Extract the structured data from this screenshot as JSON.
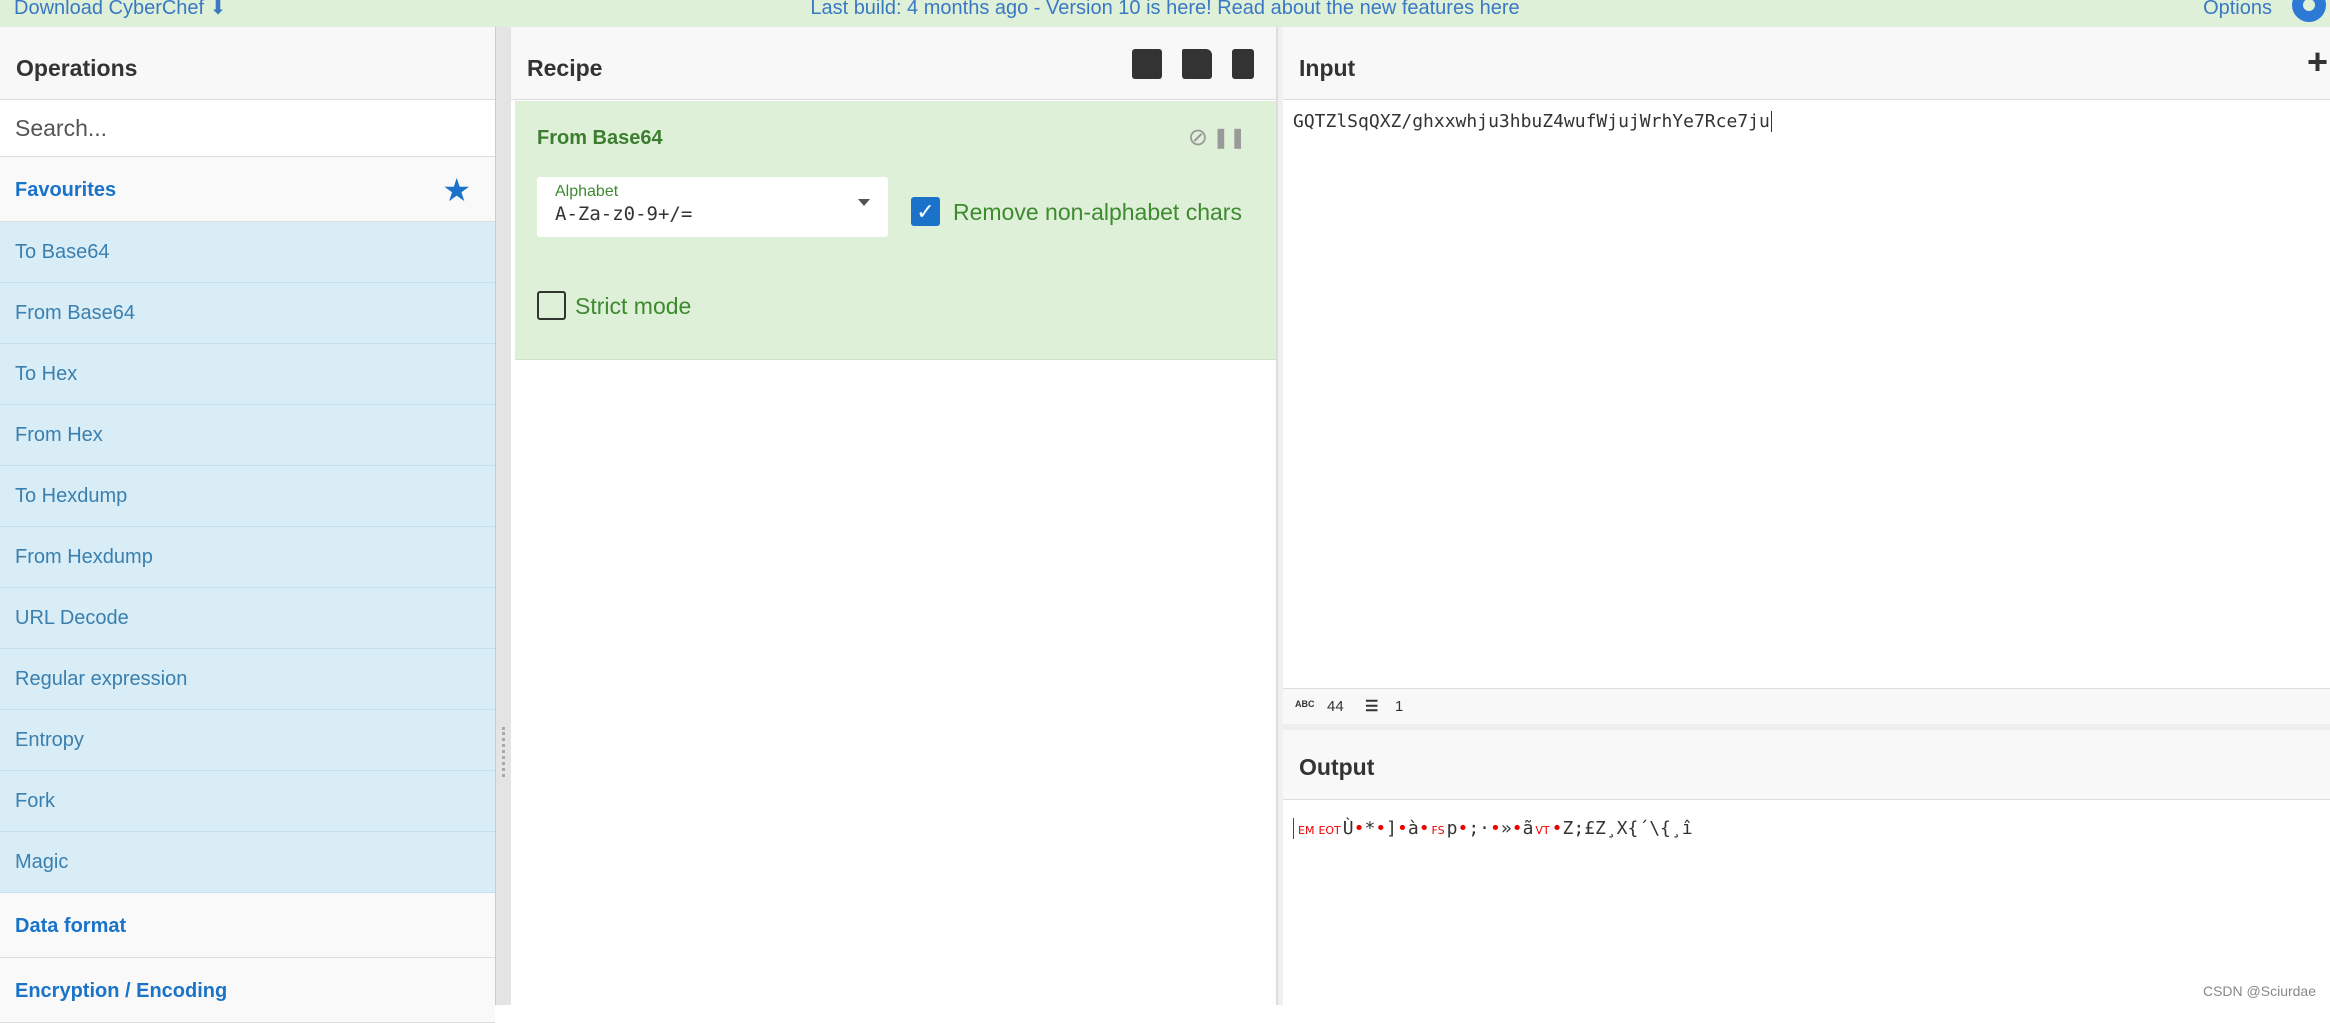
{
  "topbar": {
    "download": "Download CyberChef",
    "message_prefix": "Last build: 4 months ago - Version 10 is here! Read about the new features ",
    "message_link": "here",
    "options": "Options"
  },
  "operations": {
    "title": "Operations",
    "search_placeholder": "Search...",
    "favourites": "Favourites",
    "items": [
      "To Base64",
      "From Base64",
      "To Hex",
      "From Hex",
      "To Hexdump",
      "From Hexdump",
      "URL Decode",
      "Regular expression",
      "Entropy",
      "Fork",
      "Magic"
    ],
    "categories": [
      "Data format",
      "Encryption / Encoding"
    ]
  },
  "recipe": {
    "title": "Recipe",
    "operation": {
      "name": "From Base64",
      "alphabet_label": "Alphabet",
      "alphabet_value": "A-Za-z0-9+/=",
      "remove_label": "Remove non-alphabet chars",
      "remove_checked": true,
      "strict_label": "Strict mode",
      "strict_checked": false
    }
  },
  "input": {
    "title": "Input",
    "value": "GQTZlSqQXZ/ghxxwhju3hbuZ4wufWjujWrhYe7Rce7ju",
    "length": "44",
    "lines": "1",
    "length_icon": "ABC"
  },
  "output": {
    "title": "Output",
    "segments": [
      {
        "t": "ctrl",
        "v": "EM"
      },
      {
        "t": "ctrl",
        "v": "EOT"
      },
      {
        "t": "text",
        "v": "Ù"
      },
      {
        "t": "dot",
        "v": "•"
      },
      {
        "t": "text",
        "v": "*"
      },
      {
        "t": "dot",
        "v": "•"
      },
      {
        "t": "text",
        "v": "]"
      },
      {
        "t": "dot",
        "v": "•"
      },
      {
        "t": "text",
        "v": "à"
      },
      {
        "t": "dot",
        "v": "•"
      },
      {
        "t": "ctrl",
        "v": "FS"
      },
      {
        "t": "text",
        "v": "p"
      },
      {
        "t": "dot",
        "v": "•"
      },
      {
        "t": "text",
        "v": ";·"
      },
      {
        "t": "dot",
        "v": "•"
      },
      {
        "t": "text",
        "v": "»"
      },
      {
        "t": "dot",
        "v": "•"
      },
      {
        "t": "text",
        "v": "ã"
      },
      {
        "t": "ctrl",
        "v": "VT"
      },
      {
        "t": "dot",
        "v": "•"
      },
      {
        "t": "text",
        "v": "Z;£Z¸X{´\\{¸î"
      }
    ]
  },
  "watermark": "CSDN @Sciurdae"
}
